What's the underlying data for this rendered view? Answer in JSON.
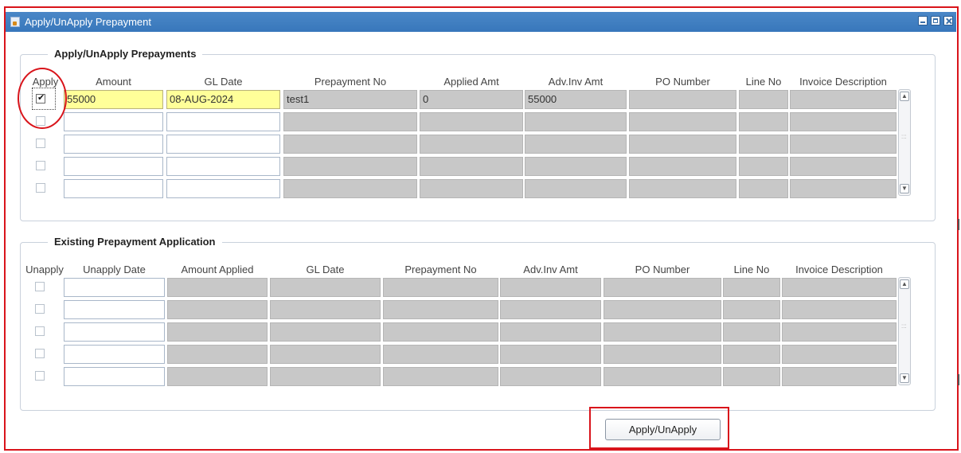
{
  "window": {
    "title": "Apply/UnApply Prepayment"
  },
  "apply_group": {
    "title": "Apply/UnApply Prepayments",
    "headers": {
      "apply": "Apply",
      "amount": "Amount",
      "gl_date": "GL Date",
      "prepayment_no": "Prepayment No",
      "applied_amt": "Applied Amt",
      "adv_inv_amt": "Adv.Inv Amt",
      "po_number": "PO Number",
      "line_no": "Line No",
      "invoice_description": "Invoice Description"
    },
    "rows": [
      {
        "apply": true,
        "amount": "55000",
        "gl_date": "08-AUG-2024",
        "prepayment_no": "test1",
        "applied_amt": "0",
        "adv_inv_amt": "55000",
        "po_number": "",
        "line_no": "",
        "invoice_description": ""
      },
      {
        "apply": false,
        "amount": "",
        "gl_date": "",
        "prepayment_no": "",
        "applied_amt": "",
        "adv_inv_amt": "",
        "po_number": "",
        "line_no": "",
        "invoice_description": ""
      },
      {
        "apply": false,
        "amount": "",
        "gl_date": "",
        "prepayment_no": "",
        "applied_amt": "",
        "adv_inv_amt": "",
        "po_number": "",
        "line_no": "",
        "invoice_description": ""
      },
      {
        "apply": false,
        "amount": "",
        "gl_date": "",
        "prepayment_no": "",
        "applied_amt": "",
        "adv_inv_amt": "",
        "po_number": "",
        "line_no": "",
        "invoice_description": ""
      },
      {
        "apply": false,
        "amount": "",
        "gl_date": "",
        "prepayment_no": "",
        "applied_amt": "",
        "adv_inv_amt": "",
        "po_number": "",
        "line_no": "",
        "invoice_description": ""
      }
    ]
  },
  "existing_group": {
    "title": "Existing Prepayment Application",
    "headers": {
      "unapply": "Unapply",
      "unapply_date": "Unapply Date",
      "amount_applied": "Amount Applied",
      "gl_date": "GL Date",
      "prepayment_no": "Prepayment No",
      "adv_inv_amt": "Adv.Inv Amt",
      "po_number": "PO Number",
      "line_no": "Line No",
      "invoice_description": "Invoice Description"
    },
    "rows": [
      {
        "unapply": false
      },
      {
        "unapply": false
      },
      {
        "unapply": false
      },
      {
        "unapply": false
      },
      {
        "unapply": false
      }
    ]
  },
  "actions": {
    "apply_unapply_label": "Apply/UnApply"
  },
  "colors": {
    "titlebar": "#3877bb",
    "highlight_red": "#d9141b",
    "required_field": "#ffff99",
    "readonly_field": "#c8c8c8"
  },
  "icons": {
    "app": "oracle-forms-icon",
    "minimize": "minimize-icon",
    "maximize": "maximize-icon",
    "close": "close-icon"
  }
}
